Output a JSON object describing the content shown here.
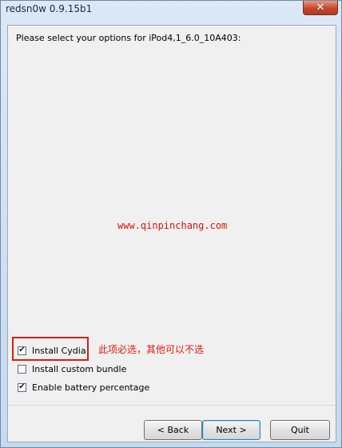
{
  "window": {
    "title": "redsn0w 0.9.15b1",
    "close_glyph": "✕"
  },
  "main": {
    "prompt": "Please select your options for iPod4,1_6.0_10A403:",
    "watermark": "www.qinpinchang.com",
    "options": [
      {
        "label": "Install Cydia",
        "checked": true
      },
      {
        "label": "Install custom bundle",
        "checked": false
      },
      {
        "label": "Enable battery percentage",
        "checked": true
      }
    ],
    "annotation": "此项必选，其他可以不选",
    "highlight_color": "#e01a10"
  },
  "buttons": {
    "back": "< Back",
    "next": "Next >",
    "quit": "Quit"
  }
}
